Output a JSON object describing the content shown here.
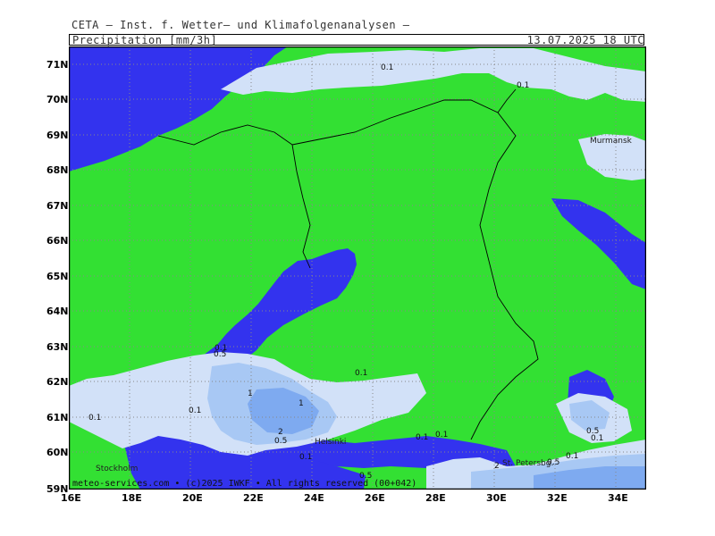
{
  "header": {
    "title": "CETA — Inst. f. Wetter— und Klimafolgenanalysen —",
    "product": "Precipitation  [mm/3h]",
    "valid_time": "13.07.2025  18 UTC"
  },
  "map": {
    "lat_labels": [
      "71N",
      "70N",
      "69N",
      "68N",
      "67N",
      "66N",
      "65N",
      "64N",
      "63N",
      "62N",
      "61N",
      "60N",
      "59N"
    ],
    "lon_labels": [
      "16E",
      "18E",
      "20E",
      "22E",
      "24E",
      "26E",
      "28E",
      "30E",
      "32E",
      "34E"
    ],
    "cities": {
      "murmansk": "Murmansk",
      "helsinki": "Helsinki",
      "stockholm": "Stockholm",
      "st_petersburg": "St. Petersbg."
    },
    "contour_labels": {
      "l1": "0.1",
      "l2": "0.1",
      "l3": "0.1",
      "l4": "0.1",
      "l5": "0.1",
      "l6": "0.1",
      "l7": "0.1",
      "l8": "0.1",
      "l9": "0.1",
      "l10": "0.1",
      "l11": "0.5",
      "l12": "0.5",
      "l13": "0.5",
      "l14": "0.5",
      "l15": "0.5",
      "l16": "1",
      "l17": "1",
      "l18": "2",
      "l19": "2",
      "l20": "0.1"
    },
    "footer": "meteo-services.com • (c)2025 IWKF • All rights reserved (00+042)",
    "colors": {
      "land": "#33e033",
      "sea": "#3333ee",
      "precip_0_1": "#d2e1f8",
      "precip_0_5": "#a8c8f4",
      "precip_1": "#7eaaf0",
      "border": "#000000",
      "grid": "#888888"
    }
  }
}
